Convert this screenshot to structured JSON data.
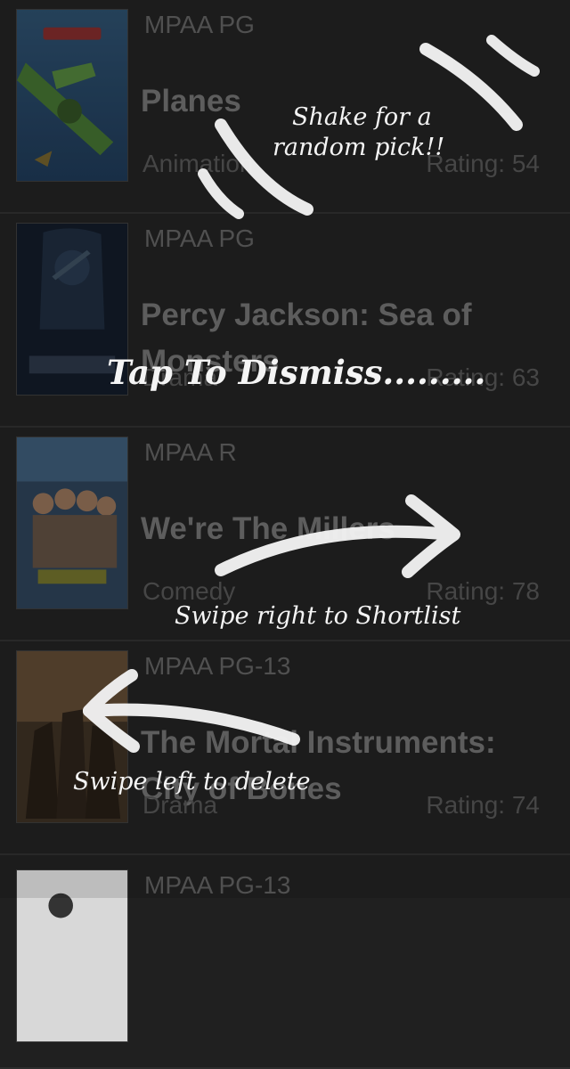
{
  "colors": {
    "background": "#202020",
    "text_dim": "#5c5c5c",
    "hint": "#f4f4f4"
  },
  "movies": [
    {
      "mpaa": "MPAA PG",
      "title": "Planes",
      "genre": "Animation",
      "rating": "Rating: 54"
    },
    {
      "mpaa": "MPAA PG",
      "title": "Percy Jackson: Sea of Monsters",
      "genre": "Drama",
      "rating": "Rating: 63"
    },
    {
      "mpaa": "MPAA R",
      "title": "We're The Millers",
      "genre": "Comedy",
      "rating": "Rating: 78"
    },
    {
      "mpaa": "MPAA PG-13",
      "title": "The Mortal Instruments: City of Bones",
      "genre": "Drama",
      "rating": "Rating: 74"
    },
    {
      "mpaa": "MPAA PG-13"
    }
  ],
  "tutorial": {
    "shake_line1": "Shake for a",
    "shake_line2": "random pick!!",
    "dismiss": "Tap To Dismiss.........",
    "swipe_right": "Swipe right to Shortlist",
    "swipe_left": "Swipe left to delete"
  },
  "icons": {
    "row_disclosure": "chevron-right-icon"
  }
}
